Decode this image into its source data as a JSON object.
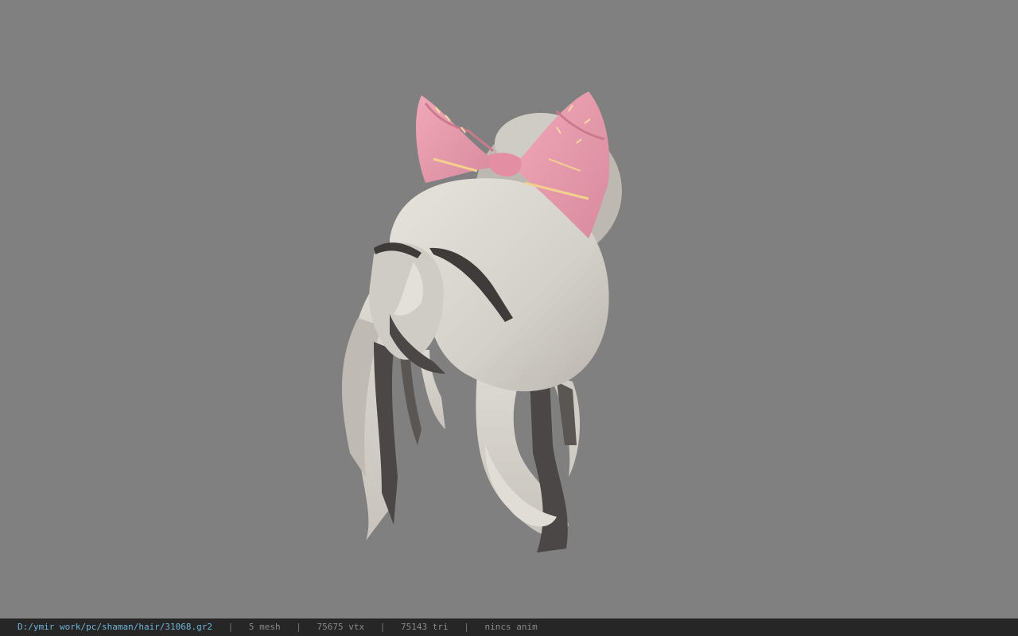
{
  "viewer": {
    "background_color": "#808080",
    "model": {
      "name": "hair-with-bow",
      "hair_color": "#d9d5cf",
      "bow_color": "#e79aae"
    }
  },
  "statusbar": {
    "path": "D:/ymir work/pc/shaman/hair/31068.gr2",
    "mesh": "5 mesh",
    "vtx": "75675 vtx",
    "tri": "75143 tri",
    "anim": "nincs anim",
    "separator": "|",
    "path_color": "#6fb5d8",
    "text_color": "#8a8a8a"
  }
}
